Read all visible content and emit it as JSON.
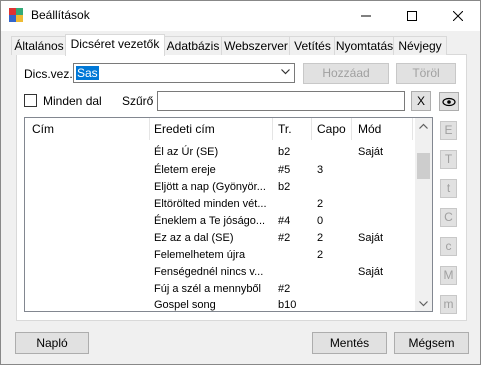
{
  "window": {
    "title": "Beállítások"
  },
  "tabs": [
    "Általános",
    "Dicséret vezetők",
    "Adatbázis",
    "Webszerver",
    "Vetítés",
    "Nyomtatás",
    "Névjegy"
  ],
  "leader": {
    "label": "Dics.vez.",
    "value": "Sas",
    "add": "Hozzáad",
    "delete": "Töröl"
  },
  "filter": {
    "all_label": "Minden dal",
    "label": "Szűrő",
    "value": "",
    "clear": "X"
  },
  "table": {
    "headers": [
      "Cím",
      "Eredeti cím",
      "Tr.",
      "Capo",
      "Mód"
    ],
    "rows": [
      [
        "",
        "Él az Úr  (SE)",
        "b2",
        "",
        "Saját"
      ],
      [
        "",
        "Életem ereje",
        "#5",
        "3",
        ""
      ],
      [
        "",
        "Eljött a nap (Gyönyör...",
        "b2",
        "",
        ""
      ],
      [
        "",
        "Eltörölted minden vét...",
        "",
        "2",
        ""
      ],
      [
        "",
        "Éneklem a Te jóságo...",
        "#4",
        "0",
        ""
      ],
      [
        "",
        "Ez az a dal (SE)",
        "#2",
        "2",
        "Saját"
      ],
      [
        "",
        "Felemelhetem újra",
        "",
        "2",
        ""
      ],
      [
        "",
        "Fenségednél nincs v...",
        "",
        "",
        "Saját"
      ],
      [
        "",
        "Fúj a szél a mennyből",
        "#2",
        "",
        ""
      ],
      [
        "",
        "Gospel song",
        "b10",
        "",
        ""
      ]
    ]
  },
  "side_buttons": [
    "E",
    "T",
    "t",
    "C",
    "c",
    "M",
    "m"
  ],
  "footer": {
    "log": "Napló",
    "save": "Mentés",
    "cancel": "Mégsem"
  }
}
